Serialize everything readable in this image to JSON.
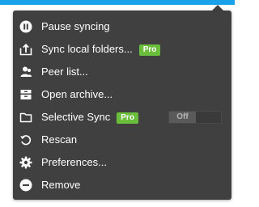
{
  "menu": {
    "items": [
      {
        "label": "Pause syncing",
        "icon": "pause-circle-icon"
      },
      {
        "label": "Sync local folders...",
        "icon": "folder-upload-icon",
        "badge": "Pro"
      },
      {
        "label": "Peer list...",
        "icon": "peers-icon"
      },
      {
        "label": "Open archive...",
        "icon": "archive-icon"
      },
      {
        "label": "Selective Sync",
        "icon": "folder-icon",
        "badge": "Pro",
        "toggle": "Off"
      },
      {
        "label": "Rescan",
        "icon": "rescan-icon"
      },
      {
        "label": "Preferences...",
        "icon": "gear-icon"
      },
      {
        "label": "Remove",
        "icon": "remove-circle-icon"
      }
    ]
  },
  "colors": {
    "menu_bg": "#404040",
    "accent_bar": "#1aa3e8",
    "pro_badge": "#6bbd3c"
  }
}
